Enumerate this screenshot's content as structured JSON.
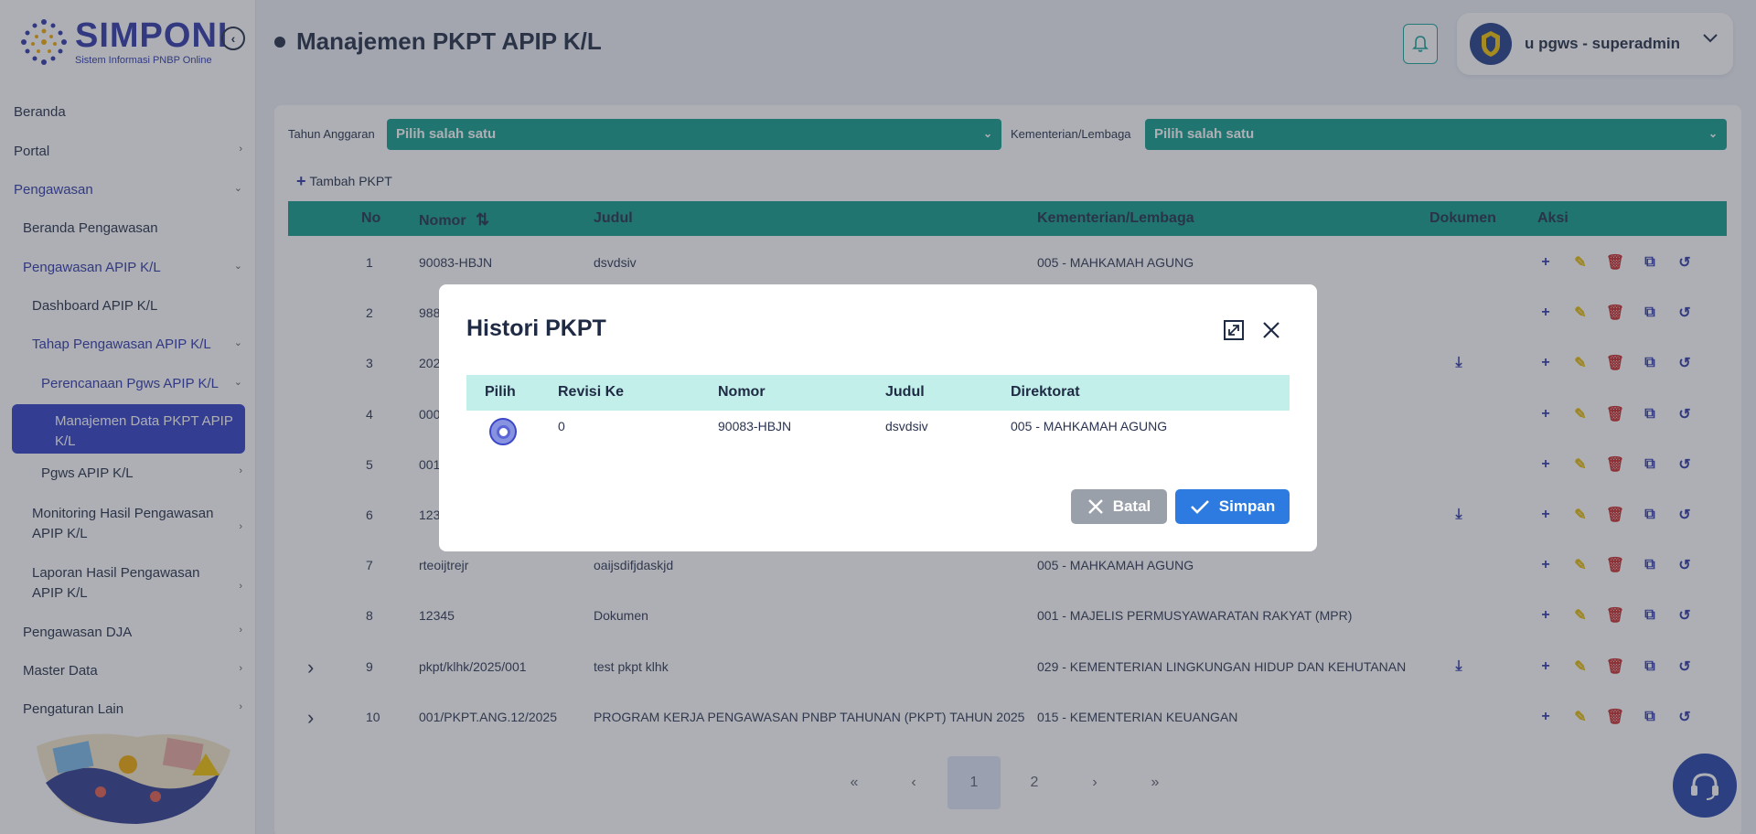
{
  "sidebar": {
    "logo_title": "SIMPONI",
    "logo_subtitle": "Sistem Informasi PNBP Online",
    "items": [
      {
        "label": "Beranda"
      },
      {
        "label": "Portal"
      },
      {
        "label": "Pengawasan"
      },
      {
        "label": "Beranda Pengawasan"
      },
      {
        "label": "Pengawasan APIP K/L"
      },
      {
        "label": "Dashboard APIP K/L"
      },
      {
        "label": "Tahap Pengawasan APIP K/L"
      },
      {
        "label": "Perencanaan Pgws APIP K/L"
      },
      {
        "label": "Manajemen Data PKPT APIP K/L"
      },
      {
        "label": "Pgws APIP K/L"
      },
      {
        "label": "Monitoring Hasil Pengawasan APIP K/L"
      },
      {
        "label": "Laporan Hasil Pengawasan APIP K/L"
      },
      {
        "label": "Pengawasan DJA"
      },
      {
        "label": "Master Data"
      },
      {
        "label": "Pengaturan Lain"
      }
    ]
  },
  "header": {
    "title": "Manajemen PKPT APIP K/L",
    "user": "u pgws - superadmin"
  },
  "filters": {
    "tahun_label": "Tahun Anggaran",
    "tahun_value": "Pilih salah satu",
    "kl_label": "Kementerian/Lembaga",
    "kl_value": "Pilih salah satu"
  },
  "add_label": "Tambah PKPT",
  "table": {
    "headers": {
      "no": "No",
      "nomor": "Nomor",
      "judul": "Judul",
      "kl": "Kementerian/Lembaga",
      "dokumen": "Dokumen",
      "aksi": "Aksi"
    },
    "rows": [
      {
        "no": "1",
        "nomor": "90083-HBJN",
        "judul": "dsvdsiv",
        "kl": "005 - MAHKAMAH AGUNG"
      },
      {
        "no": "2",
        "nomor": "988",
        "judul": "",
        "kl": ""
      },
      {
        "no": "3",
        "nomor": "202",
        "judul": "",
        "kl": ""
      },
      {
        "no": "4",
        "nomor": "000",
        "judul": "",
        "kl": ""
      },
      {
        "no": "5",
        "nomor": "001",
        "judul": "",
        "kl": ""
      },
      {
        "no": "6",
        "nomor": "123",
        "judul": "",
        "kl": ")"
      },
      {
        "no": "7",
        "nomor": "rteoijtrejr",
        "judul": "oaijsdifjdaskjd",
        "kl": "005 - MAHKAMAH AGUNG"
      },
      {
        "no": "8",
        "nomor": "12345",
        "judul": "Dokumen",
        "kl": "001 - MAJELIS PERMUSYAWARATAN RAKYAT (MPR)"
      },
      {
        "no": "9",
        "nomor": "pkpt/klhk/2025/001",
        "judul": "test pkpt klhk",
        "kl": "029 - KEMENTERIAN LINGKUNGAN HIDUP DAN KEHUTANAN"
      },
      {
        "no": "10",
        "nomor": "001/PKPT.ANG.12/2025",
        "judul": "PROGRAM KERJA PENGAWASAN PNBP TAHUNAN (PKPT) TAHUN 2025",
        "kl": "015 - KEMENTERIAN KEUANGAN"
      }
    ]
  },
  "pagination": {
    "first": "«",
    "prev": "‹",
    "pages": [
      "1",
      "2"
    ],
    "next": "›",
    "last": "»"
  },
  "modal": {
    "title": "Histori PKPT",
    "headers": {
      "pilih": "Pilih",
      "revisi": "Revisi Ke",
      "nomor": "Nomor",
      "judul": "Judul",
      "direktorat": "Direktorat"
    },
    "row": {
      "revisi": "0",
      "nomor": "90083-HBJN",
      "judul": "dsvdsiv",
      "direktorat": "005 - MAHKAMAH AGUNG"
    },
    "cancel_label": "Batal",
    "save_label": "Simpan"
  },
  "colors": {
    "primary": "#2b35a8",
    "teal": "#0d9b8a",
    "edit": "#e6b800",
    "delete": "#c62828",
    "save": "#2d7be0"
  }
}
